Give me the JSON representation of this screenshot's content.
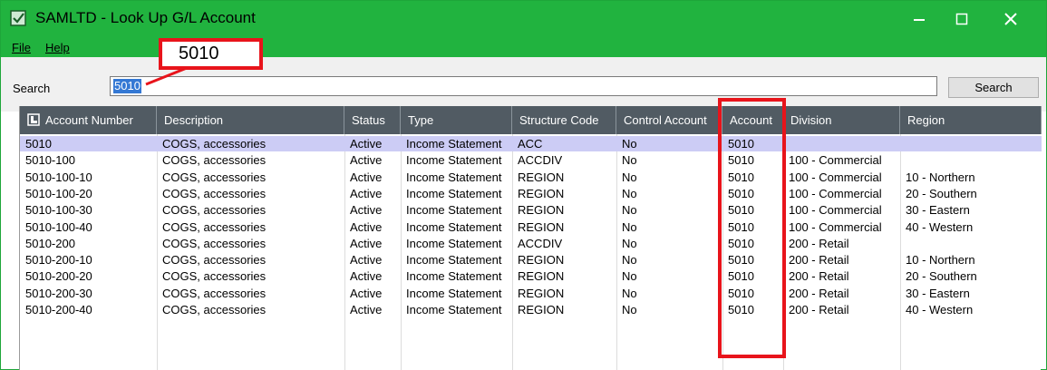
{
  "window": {
    "title": "SAMLTD - Look Up G/L Account",
    "accent": "#21b33f",
    "controls": {
      "minimize": "minimize-icon",
      "maximize": "maximize-icon",
      "close": "close-icon"
    }
  },
  "menu": {
    "items": [
      {
        "label": "File"
      },
      {
        "label": "Help"
      }
    ]
  },
  "search": {
    "label": "Search",
    "value": "5010",
    "button_label": "Search"
  },
  "callout": {
    "text": "5010",
    "highlight_color": "#e8141b"
  },
  "table": {
    "columns": [
      "Account Number",
      "Description",
      "Status",
      "Type",
      "Structure Code",
      "Control Account",
      "Account",
      "Division",
      "Region"
    ],
    "rows": [
      [
        "5010",
        "COGS, accessories",
        "Active",
        "Income Statement",
        "ACC",
        "No",
        "5010",
        "",
        ""
      ],
      [
        "5010-100",
        "COGS, accessories",
        "Active",
        "Income Statement",
        "ACCDIV",
        "No",
        "5010",
        "100 - Commercial",
        ""
      ],
      [
        "5010-100-10",
        "COGS, accessories",
        "Active",
        "Income Statement",
        "REGION",
        "No",
        "5010",
        "100 - Commercial",
        "10 - Northern"
      ],
      [
        "5010-100-20",
        "COGS, accessories",
        "Active",
        "Income Statement",
        "REGION",
        "No",
        "5010",
        "100 - Commercial",
        "20 - Southern"
      ],
      [
        "5010-100-30",
        "COGS, accessories",
        "Active",
        "Income Statement",
        "REGION",
        "No",
        "5010",
        "100 - Commercial",
        "30 - Eastern"
      ],
      [
        "5010-100-40",
        "COGS, accessories",
        "Active",
        "Income Statement",
        "REGION",
        "No",
        "5010",
        "100 - Commercial",
        "40 - Western"
      ],
      [
        "5010-200",
        "COGS, accessories",
        "Active",
        "Income Statement",
        "ACCDIV",
        "No",
        "5010",
        "200 - Retail",
        ""
      ],
      [
        "5010-200-10",
        "COGS, accessories",
        "Active",
        "Income Statement",
        "REGION",
        "No",
        "5010",
        "200 - Retail",
        "10 - Northern"
      ],
      [
        "5010-200-20",
        "COGS, accessories",
        "Active",
        "Income Statement",
        "REGION",
        "No",
        "5010",
        "200 - Retail",
        "20 - Southern"
      ],
      [
        "5010-200-30",
        "COGS, accessories",
        "Active",
        "Income Statement",
        "REGION",
        "No",
        "5010",
        "200 - Retail",
        "30 - Eastern"
      ],
      [
        "5010-200-40",
        "COGS, accessories",
        "Active",
        "Income Statement",
        "REGION",
        "No",
        "5010",
        "200 - Retail",
        "40 - Western"
      ]
    ],
    "selected_row": 0
  }
}
